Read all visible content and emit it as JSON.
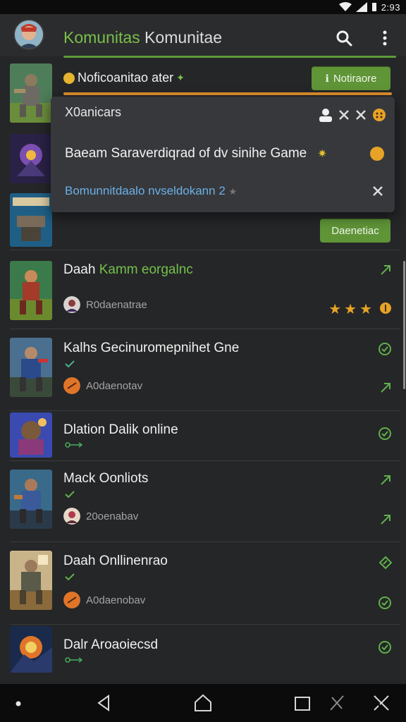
{
  "status_bar": {
    "time": "2:93"
  },
  "app_bar": {
    "title_accent": "Komunitas",
    "title_rest": " Komunitae",
    "search_icon": "search-icon",
    "menu_icon": "more-vertical-icon"
  },
  "notice": {
    "title": "Noficoanitao ater",
    "button_label": "Notiraore",
    "colors": {
      "accent_orange": "#e1902c",
      "green": "#5f9437"
    }
  },
  "popup": {
    "header": "X0anicars",
    "item": "Baeam Saraverdiqrad of dv sinihe Game",
    "link": "Bomunnitdaalo nvseldokann 2"
  },
  "action_button": {
    "label": "Daenetiac"
  },
  "games": [
    {
      "title": "Daah",
      "title_green": "Kamm eorgalnc",
      "sub": "R0daenatrae",
      "rating_stars": 3
    },
    {
      "title": "Kalhs Gecinuromepnihet Gne",
      "sub": "A0daenotav"
    },
    {
      "title": "Dlation Dalik online",
      "sub": ""
    },
    {
      "title": "Mack Oonliots",
      "sub": "20oenabav"
    },
    {
      "title": "Daah Onllinenrao",
      "sub": "A0daenobav"
    },
    {
      "title": "Dalr Aroaoiecsd",
      "sub": ""
    }
  ],
  "nav": [
    "back-icon",
    "home-icon",
    "recents-icon"
  ]
}
